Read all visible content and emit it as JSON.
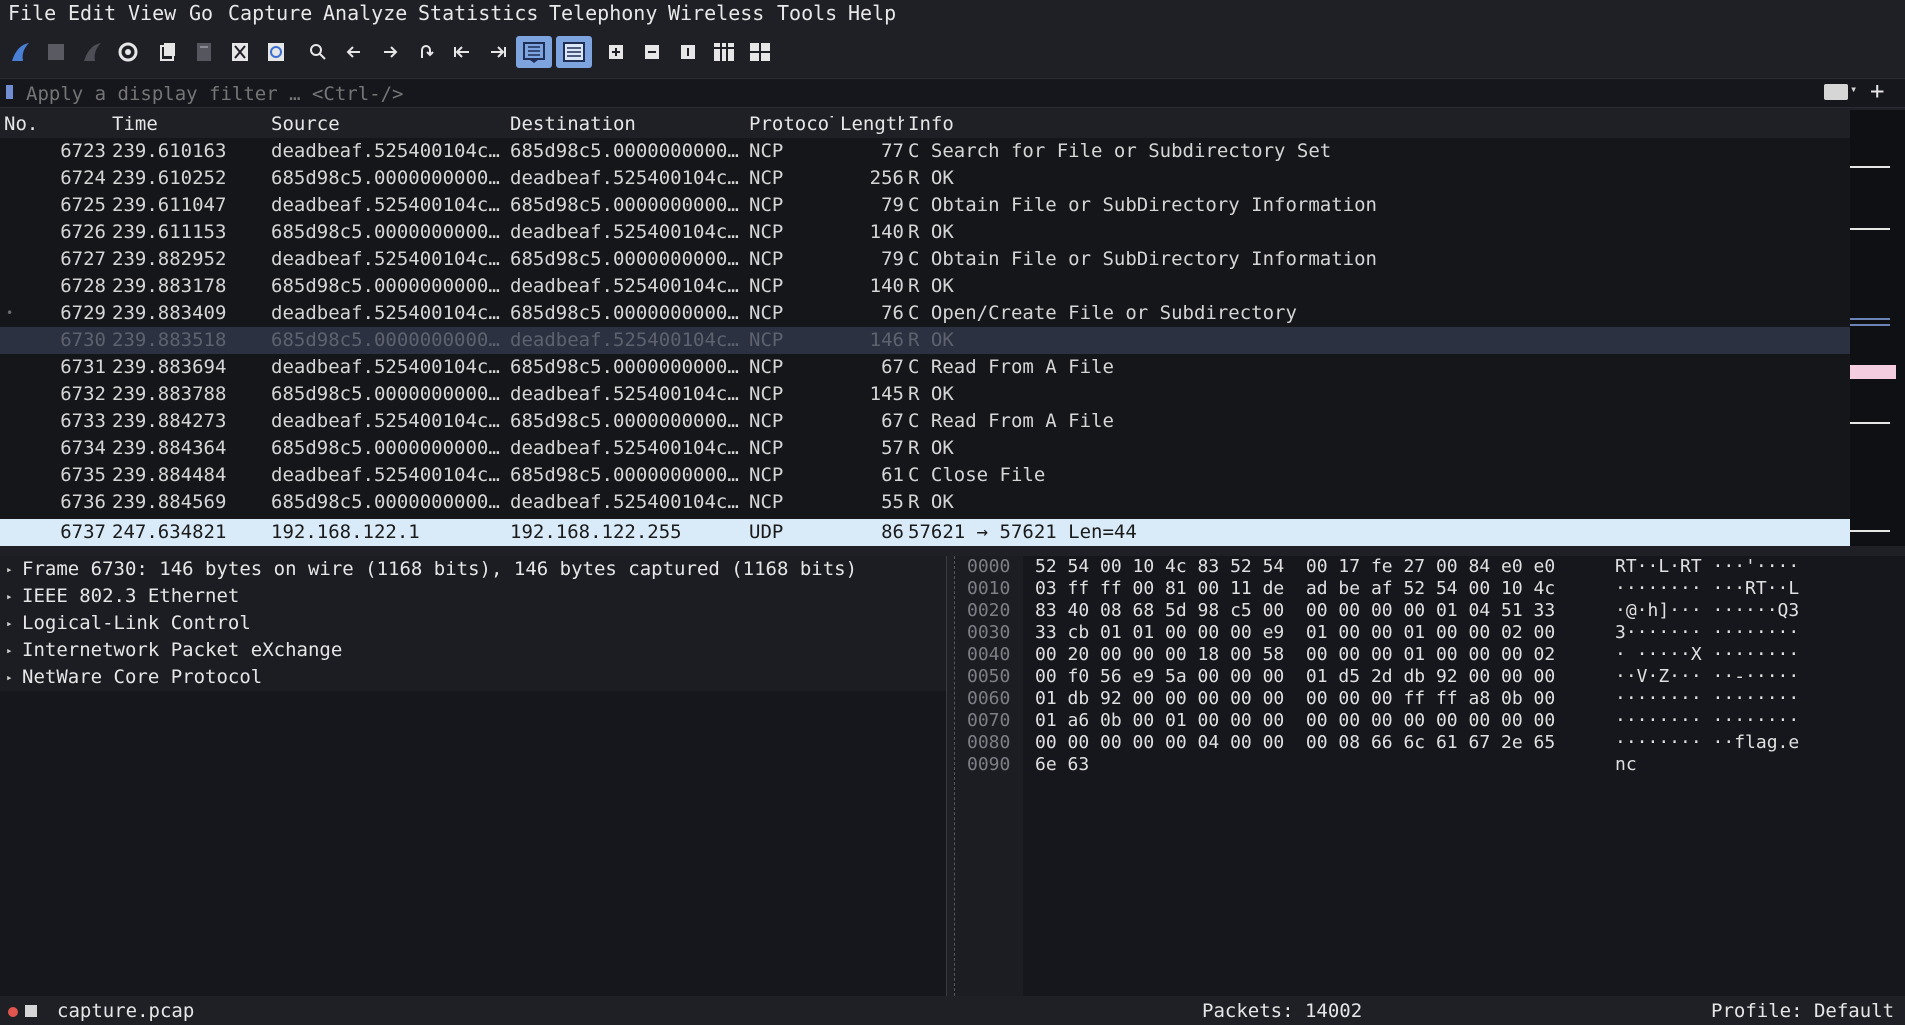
{
  "menu": [
    "File",
    "Edit",
    "View",
    "Go",
    "Capture",
    "Analyze",
    "Statistics",
    "Telephony",
    "Wireless",
    "Tools",
    "Help"
  ],
  "filter": {
    "placeholder": "Apply a display filter … <Ctrl-/>"
  },
  "columns": [
    "No.",
    "Time",
    "Source",
    "Destination",
    "Protocol",
    "Length",
    "Info"
  ],
  "packets": [
    {
      "no": "6723",
      "time": "239.610163",
      "src": "deadbeaf.525400104c…",
      "dst": "685d98c5.0000000000…",
      "proto": "NCP",
      "len": "77",
      "info": "C Search for File or Subdirectory Set"
    },
    {
      "no": "6724",
      "time": "239.610252",
      "src": "685d98c5.0000000000…",
      "dst": "deadbeaf.525400104c…",
      "proto": "NCP",
      "len": "256",
      "info": "R OK"
    },
    {
      "no": "6725",
      "time": "239.611047",
      "src": "deadbeaf.525400104c…",
      "dst": "685d98c5.0000000000…",
      "proto": "NCP",
      "len": "79",
      "info": "C Obtain File or SubDirectory Information"
    },
    {
      "no": "6726",
      "time": "239.611153",
      "src": "685d98c5.0000000000…",
      "dst": "deadbeaf.525400104c…",
      "proto": "NCP",
      "len": "140",
      "info": "R OK"
    },
    {
      "no": "6727",
      "time": "239.882952",
      "src": "deadbeaf.525400104c…",
      "dst": "685d98c5.0000000000…",
      "proto": "NCP",
      "len": "79",
      "info": "C Obtain File or SubDirectory Information"
    },
    {
      "no": "6728",
      "time": "239.883178",
      "src": "685d98c5.0000000000…",
      "dst": "deadbeaf.525400104c…",
      "proto": "NCP",
      "len": "140",
      "info": "R OK"
    },
    {
      "no": "6729",
      "time": "239.883409",
      "src": "deadbeaf.525400104c…",
      "dst": "685d98c5.0000000000…",
      "proto": "NCP",
      "len": "76",
      "info": "C Open/Create File or Subdirectory"
    },
    {
      "no": "6730",
      "time": "239.883518",
      "src": "685d98c5.0000000000…",
      "dst": "deadbeaf.525400104c…",
      "proto": "NCP",
      "len": "146",
      "info": "R OK"
    },
    {
      "no": "6731",
      "time": "239.883694",
      "src": "deadbeaf.525400104c…",
      "dst": "685d98c5.0000000000…",
      "proto": "NCP",
      "len": "67",
      "info": "C Read From A File"
    },
    {
      "no": "6732",
      "time": "239.883788",
      "src": "685d98c5.0000000000…",
      "dst": "deadbeaf.525400104c…",
      "proto": "NCP",
      "len": "145",
      "info": "R OK"
    },
    {
      "no": "6733",
      "time": "239.884273",
      "src": "deadbeaf.525400104c…",
      "dst": "685d98c5.0000000000…",
      "proto": "NCP",
      "len": "67",
      "info": "C Read From A File"
    },
    {
      "no": "6734",
      "time": "239.884364",
      "src": "685d98c5.0000000000…",
      "dst": "deadbeaf.525400104c…",
      "proto": "NCP",
      "len": "57",
      "info": "R OK"
    },
    {
      "no": "6735",
      "time": "239.884484",
      "src": "deadbeaf.525400104c…",
      "dst": "685d98c5.0000000000…",
      "proto": "NCP",
      "len": "61",
      "info": "C Close File"
    },
    {
      "no": "6736",
      "time": "239.884569",
      "src": "685d98c5.0000000000…",
      "dst": "deadbeaf.525400104c…",
      "proto": "NCP",
      "len": "55",
      "info": "R OK"
    },
    {
      "no": "6737",
      "time": "247.634821",
      "src": "192.168.122.1",
      "dst": "192.168.122.255",
      "proto": "UDP",
      "len": "86",
      "info": "57621 → 57621 Len=44"
    }
  ],
  "details": [
    "Frame 6730: 146 bytes on wire (1168 bits), 146 bytes captured (1168 bits)",
    "IEEE 802.3 Ethernet",
    "Logical-Link Control",
    "Internetwork Packet eXchange",
    "NetWare Core Protocol"
  ],
  "bytes": [
    {
      "off": "0000",
      "hex": "52 54 00 10 4c 83 52 54  00 17 fe 27 00 84 e0 e0",
      "ascii": "RT··L·RT ···'····"
    },
    {
      "off": "0010",
      "hex": "03 ff ff 00 81 00 11 de  ad be af 52 54 00 10 4c",
      "ascii": "········ ···RT··L"
    },
    {
      "off": "0020",
      "hex": "83 40 08 68 5d 98 c5 00  00 00 00 00 01 04 51 33",
      "ascii": "·@·h]··· ······Q3"
    },
    {
      "off": "0030",
      "hex": "33 cb 01 01 00 00 00 e9  01 00 00 01 00 00 02 00",
      "ascii": "3······· ········"
    },
    {
      "off": "0040",
      "hex": "00 20 00 00 00 18 00 58  00 00 00 01 00 00 00 02",
      "ascii": "· ·····X ········"
    },
    {
      "off": "0050",
      "hex": "00 f0 56 e9 5a 00 00 00  01 d5 2d db 92 00 00 00",
      "ascii": "··V·Z··· ··-·····"
    },
    {
      "off": "0060",
      "hex": "01 db 92 00 00 00 00 00  00 00 00 ff ff a8 0b 00",
      "ascii": "········ ········"
    },
    {
      "off": "0070",
      "hex": "01 a6 0b 00 01 00 00 00  00 00 00 00 00 00 00 00",
      "ascii": "········ ········"
    },
    {
      "off": "0080",
      "hex": "00 00 00 00 00 04 00 00  00 08 66 6c 61 67 2e 65",
      "ascii": "········ ··flag.e"
    },
    {
      "off": "0090",
      "hex": "6e 63",
      "ascii": "nc"
    }
  ],
  "status": {
    "file": "capture.pcap",
    "packets": "Packets: 14002",
    "profile": "Profile: Default"
  },
  "colors": {
    "selected": "#d9ebf9",
    "dim_selected": "#2b3140",
    "background": "#15161a"
  }
}
